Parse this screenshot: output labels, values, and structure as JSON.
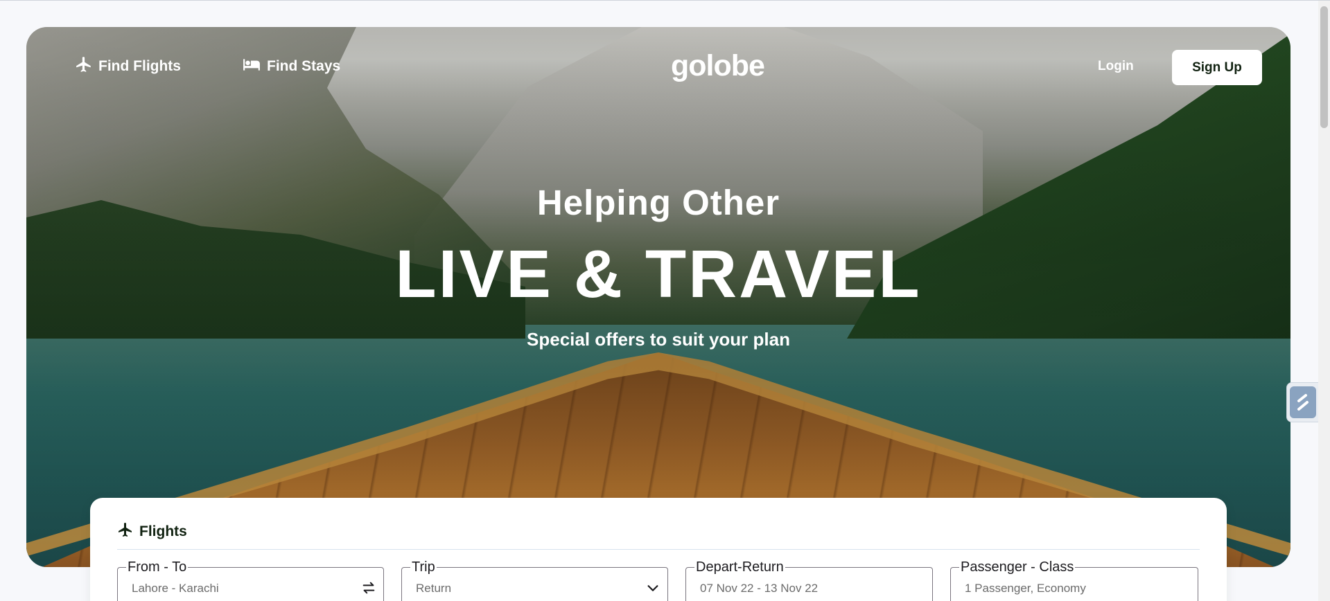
{
  "nav": {
    "find_flights": "Find Flights",
    "find_stays": "Find Stays",
    "logo": "golobe",
    "login": "Login",
    "signup": "Sign Up"
  },
  "hero": {
    "subtitle": "Helping Other",
    "title": "LIVE & TRAVEL",
    "tagline": "Special offers to suit your plan"
  },
  "search": {
    "tab": "Flights",
    "fields": [
      {
        "label": "From - To",
        "value": "Lahore - Karachi",
        "icon": "swap-icon"
      },
      {
        "label": "Trip",
        "value": "Return",
        "icon": "chevron-down-icon"
      },
      {
        "label": "Depart-Return",
        "value": "07 Nov 22 - 13 Nov 22"
      },
      {
        "label": "Passenger - Class",
        "value": "1 Passenger, Economy"
      }
    ]
  },
  "colors": {
    "brand_mint": "#8dd3bb",
    "text_dark": "#112211",
    "white": "#ffffff"
  }
}
